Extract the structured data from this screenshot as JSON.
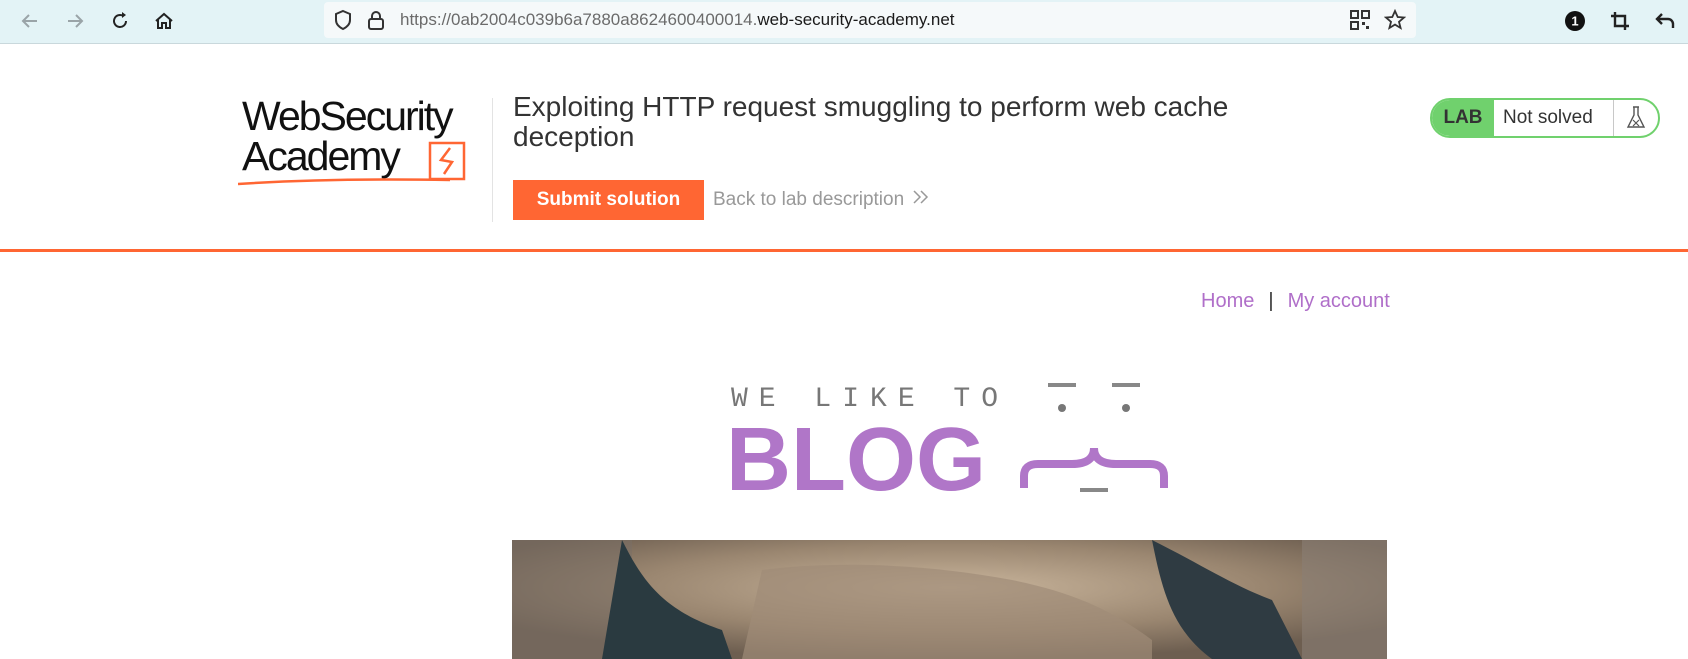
{
  "browser": {
    "url_prefix": "https://0ab2004c039b6a7880a8624600400014.",
    "url_domain": "web-security-academy.net",
    "extension_badge": "1",
    "icons": [
      "back-arrow-icon",
      "forward-arrow-icon",
      "reload-icon",
      "home-icon",
      "shield-icon",
      "lock-icon",
      "qr-code-icon",
      "star-icon",
      "extension-icon",
      "crop-icon",
      "undo-icon"
    ]
  },
  "header": {
    "logo_line1": "WebSecurity",
    "logo_line2": "Academy",
    "lab_title": "Exploiting HTTP request smuggling to perform web cache deception",
    "submit_label": "Submit solution",
    "back_label": "Back to lab description",
    "badge_label": "LAB",
    "badge_status": "Not solved"
  },
  "nav": {
    "home_label": "Home",
    "separator": "|",
    "account_label": "My account"
  },
  "blog": {
    "tagline": "WE LIKE TO",
    "word": "BLOG"
  },
  "colors": {
    "accent": "#ff6633",
    "link_purple": "#b06fc9",
    "badge_green": "#70d16d",
    "toolbar_bg": "#e3f3f6"
  }
}
